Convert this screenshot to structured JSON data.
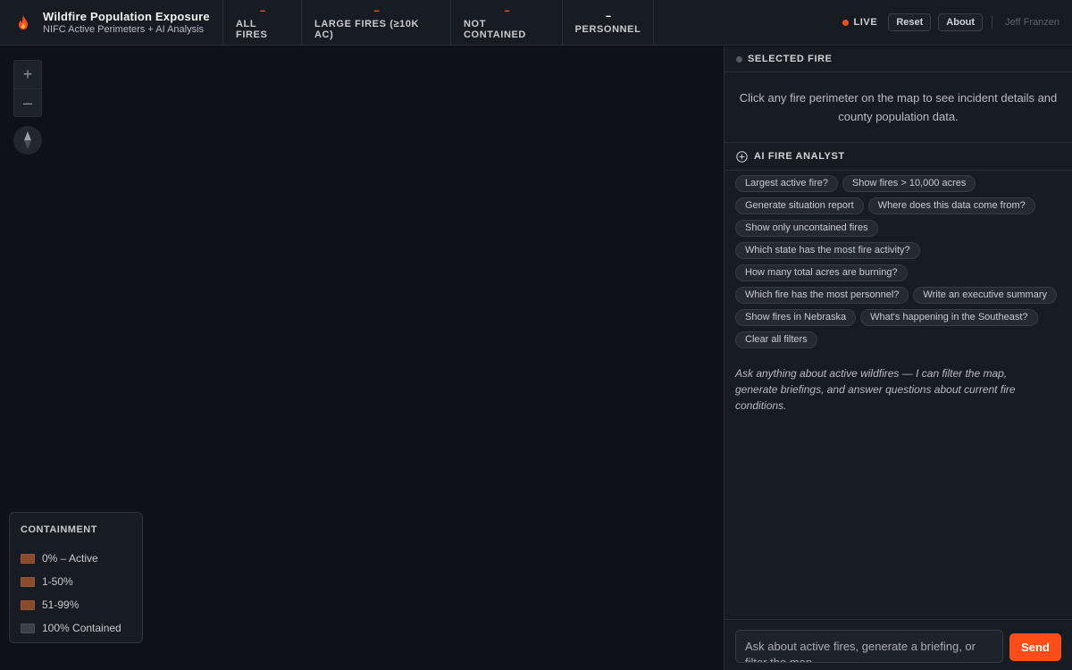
{
  "header": {
    "title": "Wildfire Population Exposure",
    "subtitle": "NIFC Active Perimeters + AI Analysis",
    "stats": [
      {
        "value": "--",
        "label": "ALL FIRES"
      },
      {
        "value": "--",
        "label": "LARGE FIRES (≥10K AC)"
      },
      {
        "value": "--",
        "label": "NOT CONTAINED"
      },
      {
        "value": "--",
        "label": "PERSONNEL"
      }
    ],
    "live_label": "LIVE",
    "reset_label": "Reset",
    "about_label": "About",
    "user": "Jeff Franzen"
  },
  "map": {
    "zoom_in": "+",
    "zoom_out": "–",
    "legend": {
      "title": "CONTAINMENT",
      "items": [
        {
          "label": "0% – Active",
          "color": "#8a4a2c"
        },
        {
          "label": "1-50%",
          "color": "#8a4a2c"
        },
        {
          "label": "51-99%",
          "color": "#8a4a2c"
        },
        {
          "label": "100% Contained",
          "color": "#3c4047"
        }
      ]
    }
  },
  "panel": {
    "selected_title": "SELECTED FIRE",
    "selected_message": "Click any fire perimeter on the map to see incident details and county population data.",
    "ai_title": "AI FIRE ANALYST",
    "chips": [
      "Largest active fire?",
      "Show fires > 10,000 acres",
      "Generate situation report",
      "Where does this data come from?",
      "Show only uncontained fires",
      "Which state has the most fire activity?",
      "How many total acres are burning?",
      "Which fire has the most personnel?",
      "Write an executive summary",
      "Show fires in Nebraska",
      "What's happening in the Southeast?",
      "Clear all filters"
    ],
    "ai_message": "Ask anything about active wildfires — I can filter the map, generate briefings, and answer questions about current fire conditions.",
    "input_placeholder": "Ask about active fires, generate a briefing, or filter the map...",
    "send_label": "Send"
  },
  "colors": {
    "accent": "#ff4d1a",
    "stat_value": "#e8582a"
  }
}
